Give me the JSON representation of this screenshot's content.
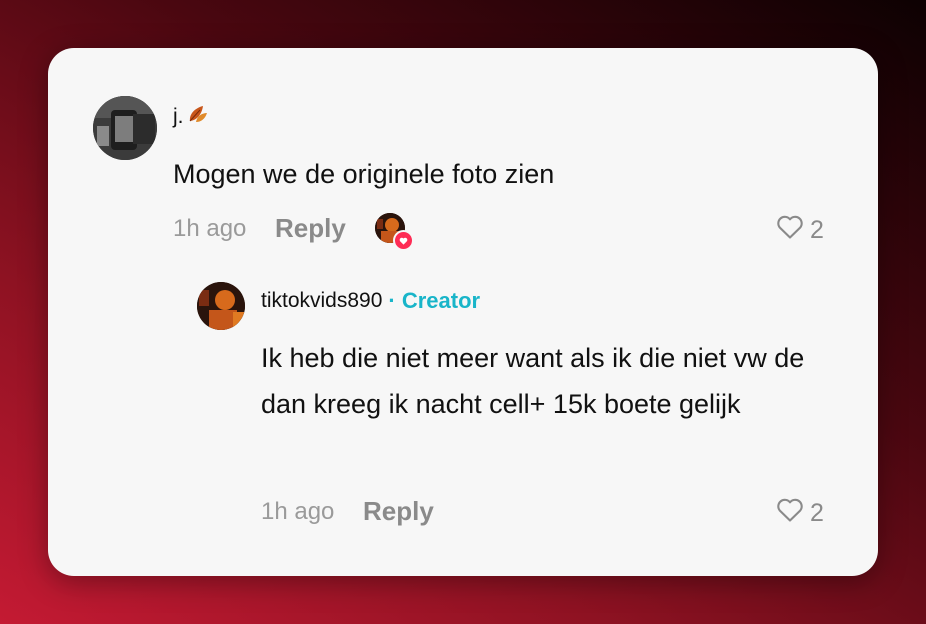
{
  "comment": {
    "username": "j.",
    "username_emoji_icon": "leaf-icon",
    "text": "Mogen we de originele foto zien",
    "time": "1h ago",
    "reply_label": "Reply",
    "likes": "2",
    "liked_by_creator": true
  },
  "reply_comment": {
    "username": "tiktokvids890",
    "creator_label": "· Creator",
    "text": "Ik heb die niet meer want als ik die niet vw de dan kreeg ik nacht cell+ 15k boete gelijk",
    "time": "1h ago",
    "reply_label": "Reply",
    "likes": "2"
  },
  "colors": {
    "creator_accent": "#19b5c9",
    "like_badge": "#fe2c55",
    "card_bg": "#f7f7f7",
    "bg_gradient_start": "#c41a33",
    "bg_gradient_end": "#0d0102"
  }
}
